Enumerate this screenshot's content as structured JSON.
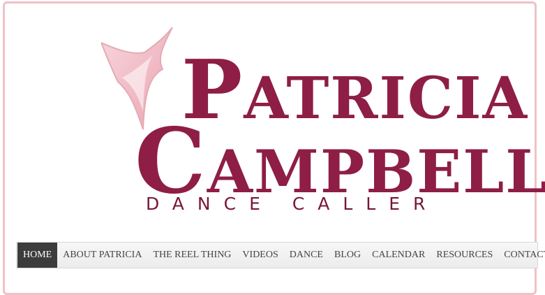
{
  "logo": {
    "line1_initial": "P",
    "line1_rest": "ATRICIA",
    "line2_initial": "C",
    "line2_rest": "AMPBELL",
    "tagline": "DANCE CALLER",
    "icon": "four-point-star-icon",
    "colors": {
      "text": "#8e1e46",
      "star": "#f0b8c2"
    }
  },
  "nav": {
    "items": [
      {
        "label": "HOME",
        "active": true
      },
      {
        "label": "ABOUT PATRICIA"
      },
      {
        "label": "THE REEL THING"
      },
      {
        "label": "VIDEOS"
      },
      {
        "label": "DANCE"
      },
      {
        "label": "BLOG"
      },
      {
        "label": "CALENDAR"
      },
      {
        "label": "RESOURCES"
      },
      {
        "label": "CONTACT"
      }
    ]
  },
  "colors": {
    "frame_border": "#efc1c7",
    "nav_active_bg": "#3c3c3c"
  }
}
